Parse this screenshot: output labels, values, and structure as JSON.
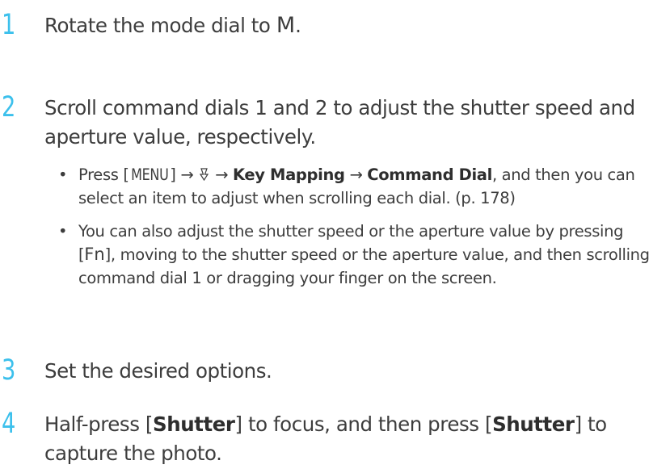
{
  "steps": [
    {
      "number": "1",
      "text": "Rotate the mode dial to",
      "mode": "M",
      "end": "."
    },
    {
      "number": "2",
      "text": "Scroll command dials 1 and 2 to adjust the shutter speed and aperture value, respectively."
    },
    {
      "number": "3",
      "text": "Set the desired options."
    },
    {
      "number": "4",
      "pre": "Half-press [",
      "shutter": "Shutter",
      "mid": "] to focus, and then press [",
      "shutter2": "Shutter",
      "post": "] to capture the photo."
    }
  ],
  "bullets": {
    "first": {
      "pre": "Press [",
      "menu": "MENU",
      "post_menu": "] → ",
      "icon": "custom-settings-icon",
      "icon_glyph": "ᕓ",
      "arrow": " → ",
      "key_mapping": "Key Mapping",
      "arrow2": " → ",
      "command_dial": "Command Dial",
      "tail": ", and then you can select an item to adjust when scrolling each dial. (p. 178)"
    },
    "second": {
      "pre": "You can also adjust the shutter speed or the aperture value by pressing [",
      "fn": "Fn",
      "tail": "], moving to the shutter speed or the aperture value, and then scrolling command dial 1 or dragging your finger on the screen."
    }
  },
  "colors": {
    "accent": "#3cc0ec",
    "text": "#3d3d3d"
  }
}
